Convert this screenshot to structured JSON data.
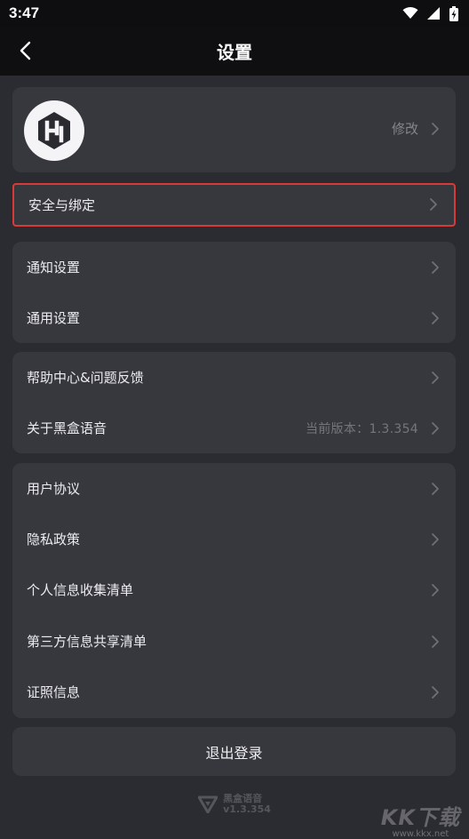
{
  "status_bar": {
    "time": "3:47"
  },
  "header": {
    "title": "设置"
  },
  "profile": {
    "edit_label": "修改"
  },
  "security": {
    "label": "安全与绑定"
  },
  "groups": [
    {
      "items": [
        {
          "label": "通知设置"
        },
        {
          "label": "通用设置"
        }
      ]
    },
    {
      "items": [
        {
          "label": "帮助中心&问题反馈"
        },
        {
          "label": "关于黑盒语音",
          "value": "当前版本：1.3.354"
        }
      ]
    },
    {
      "items": [
        {
          "label": "用户协议"
        },
        {
          "label": "隐私政策"
        },
        {
          "label": "个人信息收集清单"
        },
        {
          "label": "第三方信息共享清单"
        },
        {
          "label": "证照信息"
        }
      ]
    }
  ],
  "logout": {
    "label": "退出登录"
  },
  "footer": {
    "app_name": "黑盒语音",
    "version": "v1.3.354"
  },
  "watermark": {
    "main": "KK下载",
    "sub": "www.kkx.net"
  },
  "colors": {
    "background": "#2b2c32",
    "card": "#37383e",
    "header": "#0f0f11",
    "highlight_border": "#d83a3a"
  }
}
